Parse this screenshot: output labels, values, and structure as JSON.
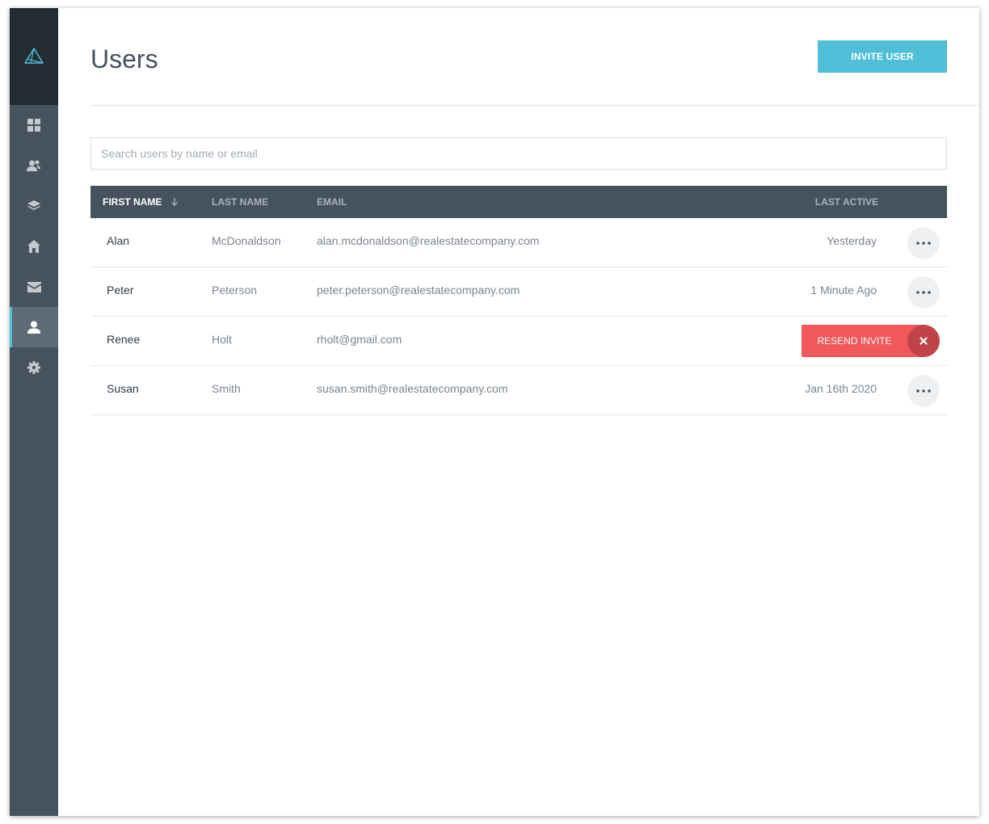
{
  "colors": {
    "sidebar": "#46535f",
    "sidebar_logo_bg": "#232b33",
    "accent": "#4fbed6",
    "danger": "#f2575b",
    "danger_dark": "#c0434a",
    "table_header": "#46535f"
  },
  "sidebar": {
    "logo_icon": "triangle-logo-icon",
    "items": [
      {
        "icon": "dashboard-grid-icon",
        "active": false
      },
      {
        "icon": "contacts-icon",
        "active": false
      },
      {
        "icon": "layers-icon",
        "active": false
      },
      {
        "icon": "home-icon",
        "active": false
      },
      {
        "icon": "mail-icon",
        "active": false
      },
      {
        "icon": "user-icon",
        "active": true
      },
      {
        "icon": "gear-icon",
        "active": false
      }
    ]
  },
  "header": {
    "title": "Users",
    "invite_label": "INVITE USER"
  },
  "search": {
    "placeholder": "Search users by name or email",
    "value": ""
  },
  "table": {
    "columns": {
      "first_name": "FIRST NAME",
      "last_name": "LAST NAME",
      "email": "EMAIL",
      "last_active": "LAST ACTIVE"
    },
    "sort_icon": "arrow-down-icon",
    "rows": [
      {
        "first": "Alan",
        "last": "McDonaldson",
        "email": "alan.mcdonaldson@realestatecompany.com",
        "last_active": "Yesterday",
        "action": "more"
      },
      {
        "first": "Peter",
        "last": "Peterson",
        "email": "peter.peterson@realestatecompany.com",
        "last_active": "1 Minute Ago",
        "action": "more"
      },
      {
        "first": "Renee",
        "last": "Holt",
        "email": "rholt@gmail.com",
        "last_active": "",
        "action": "resend",
        "resend_label": "RESEND INVITE"
      },
      {
        "first": "Susan",
        "last": "Smith",
        "email": "susan.smith@realestatecompany.com",
        "last_active": "Jan 16th 2020",
        "action": "more"
      }
    ]
  }
}
